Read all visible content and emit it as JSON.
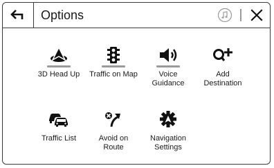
{
  "header": {
    "title": "Options",
    "back_icon": "back-arrow-icon",
    "music_icon": "music-note-icon",
    "close_icon": "close-icon"
  },
  "options": [
    {
      "label": "3D Head Up",
      "icon": "navigation-arrow-icon",
      "indicator": true
    },
    {
      "label": "Traffic on Map",
      "icon": "traffic-light-icon",
      "indicator": true
    },
    {
      "label": "Voice\nGuidance",
      "icon": "speaker-icon",
      "indicator": true
    },
    {
      "label": "Add\nDestination",
      "icon": "add-destination-icon",
      "indicator": false
    },
    {
      "label": "Traffic List",
      "icon": "cars-icon",
      "indicator": false
    },
    {
      "label": "Avoid on\nRoute",
      "icon": "avoid-route-icon",
      "indicator": false
    },
    {
      "label": "Navigation\nSettings",
      "icon": "navigation-gear-icon",
      "indicator": false
    }
  ],
  "colors": {
    "border": "#3a3a3a",
    "indicator": "#9a9a9a",
    "text": "#1a1a1a"
  }
}
